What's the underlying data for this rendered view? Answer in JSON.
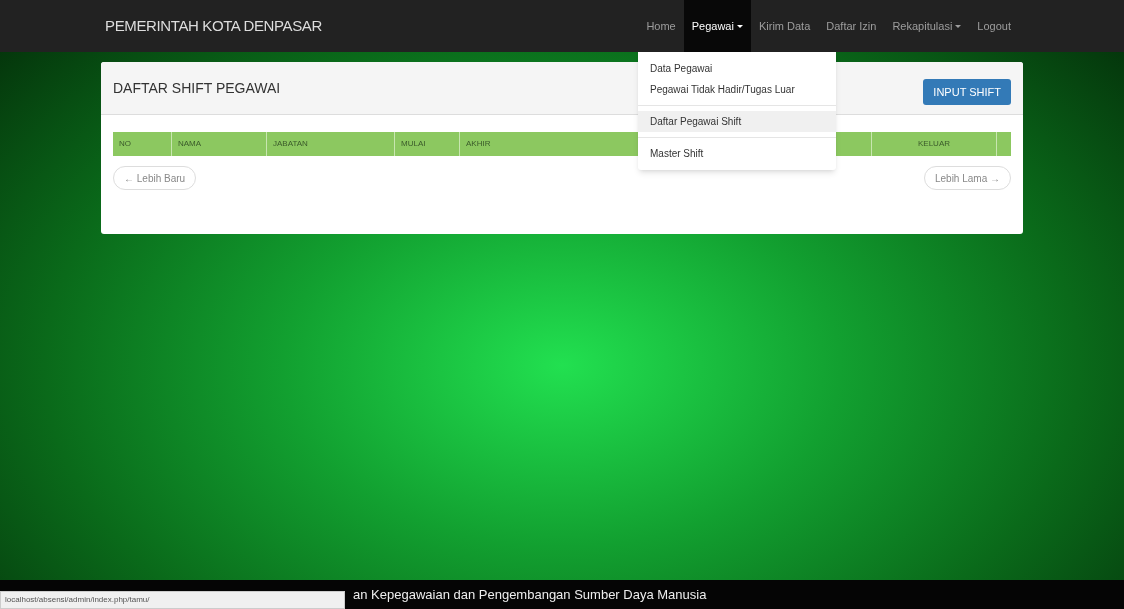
{
  "navbar": {
    "brand": "PEMERINTAH KOTA DENPASAR",
    "items": [
      {
        "label": "Home",
        "dropdown": false,
        "selected": false
      },
      {
        "label": "Pegawai",
        "dropdown": true,
        "selected": true
      },
      {
        "label": "Kirim Data",
        "dropdown": false,
        "selected": false
      },
      {
        "label": "Daftar Izin",
        "dropdown": false,
        "selected": false
      },
      {
        "label": "Rekapitulasi",
        "dropdown": true,
        "selected": false
      },
      {
        "label": "Logout",
        "dropdown": false,
        "selected": false
      }
    ]
  },
  "dropdown": [
    {
      "label": "Data Pegawai",
      "selected": false
    },
    {
      "label": "Pegawai Tidak Hadir/Tugas Luar",
      "selected": false
    },
    {
      "label": "Daftar Pegawai Shift",
      "selected": true
    },
    {
      "label": "Master Shift",
      "selected": false
    }
  ],
  "panel": {
    "title": "DAFTAR SHIFT PEGAWAI",
    "button": "INPUT SHIFT",
    "columns": [
      "NO",
      "NAMA",
      "JABATAN",
      "MULAI",
      "AKHIR",
      "KELUAR"
    ],
    "pager": {
      "newer": "← Lebih Baru",
      "older": "Lebih Lama →"
    }
  },
  "footer": "an Kepegawaian dan Pengembangan Sumber Daya Manusia",
  "status_bar": "localhost/absensi/admin/index.php/tamu/"
}
